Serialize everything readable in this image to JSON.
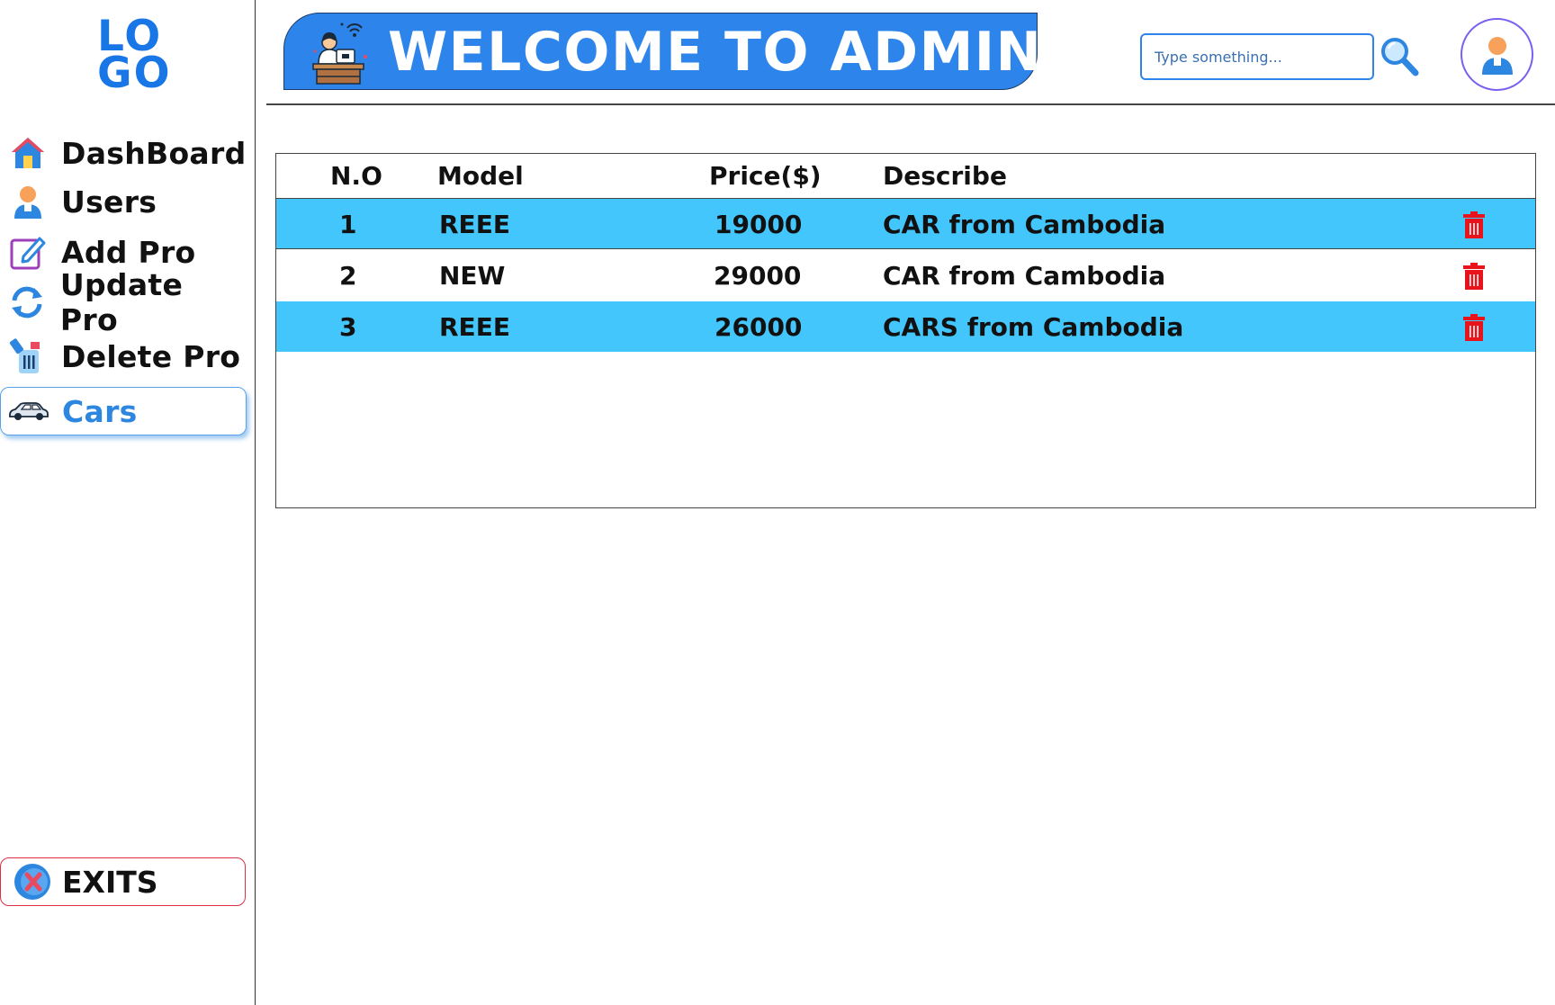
{
  "logo": {
    "line1": "LO",
    "line2": "GO"
  },
  "sidebar": {
    "items": [
      {
        "label": "DashBoard",
        "icon": "home-icon"
      },
      {
        "label": "Users",
        "icon": "user-icon"
      },
      {
        "label": "Add Pro",
        "icon": "edit-icon"
      },
      {
        "label": "Update Pro",
        "icon": "refresh-icon"
      },
      {
        "label": "Delete Pro",
        "icon": "trash-can-icon"
      },
      {
        "label": "Cars",
        "icon": "car-icon",
        "active": true
      }
    ],
    "exit_label": "EXITS"
  },
  "header": {
    "title": "WELCOME TO ADMIN",
    "search_placeholder": "Type something...",
    "accent": "#2d84ea"
  },
  "table": {
    "columns": [
      "N.O",
      "Model",
      "Price($)",
      "Describe"
    ],
    "rows": [
      {
        "no": "1",
        "model": "REEE",
        "price": "19000",
        "describe": "CAR from Cambodia"
      },
      {
        "no": "2",
        "model": "NEW",
        "price": "29000",
        "describe": "CAR from Cambodia"
      },
      {
        "no": "3",
        "model": "REEE",
        "price": "26000",
        "describe": "CARS from Cambodia"
      }
    ],
    "row_highlight": "#43c6fb",
    "delete_color": "#e8131b"
  }
}
